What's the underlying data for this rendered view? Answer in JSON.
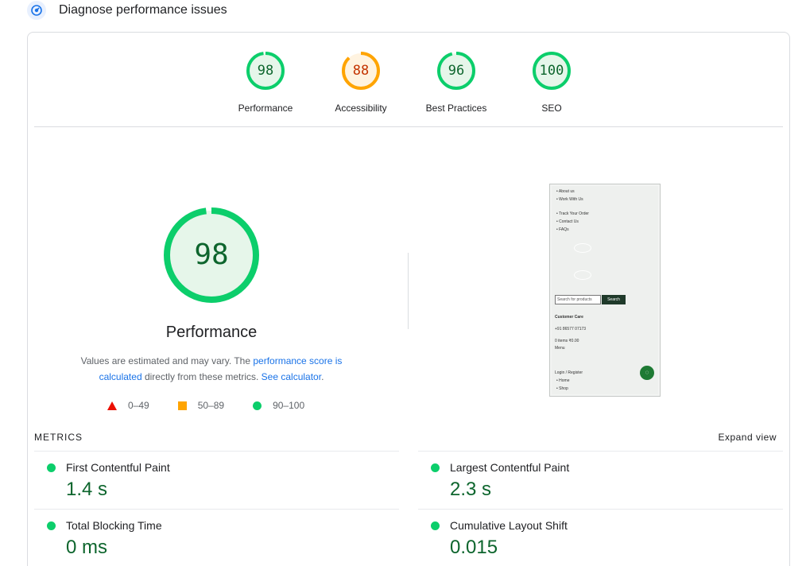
{
  "header": {
    "title": "Diagnose performance issues",
    "icon": "speed-icon"
  },
  "categories": [
    {
      "score": "98",
      "label": "Performance",
      "value": 98,
      "color": "#0cce6b",
      "fill": "#e6f6ea",
      "text": "#0d652d"
    },
    {
      "score": "88",
      "label": "Accessibility",
      "value": 88,
      "color": "#ffa400",
      "fill": "#fff3e0",
      "text": "#c33300"
    },
    {
      "score": "96",
      "label": "Best Practices",
      "value": 96,
      "color": "#0cce6b",
      "fill": "#e6f6ea",
      "text": "#0d652d"
    },
    {
      "score": "100",
      "label": "SEO",
      "value": 100,
      "color": "#0cce6b",
      "fill": "#e6f6ea",
      "text": "#0d652d"
    }
  ],
  "performance": {
    "score": "98",
    "value": 98,
    "title": "Performance",
    "desc_prefix": "Values are estimated and may vary. The ",
    "desc_link": "performance score is calculated",
    "desc_middle": " directly from these metrics. ",
    "desc_calc": "See calculator",
    "desc_suffix": "."
  },
  "legend": {
    "poor": "0–49",
    "average": "50–89",
    "good": "90–100"
  },
  "screenshot": {
    "items": [
      "About us",
      "Work With Us",
      "Track Your Order",
      "Contact Us",
      "FAQs"
    ],
    "search_placeholder": "Search for products",
    "search_button": "Search",
    "customer_care": "Customer Care",
    "phone": "+91 86577 07173",
    "cart": "0 items ₹0.00",
    "menu": "Menu",
    "login": "Login / Register",
    "nav": [
      "Home",
      "Shop"
    ]
  },
  "metrics": {
    "title": "METRICS",
    "expand": "Expand view",
    "items": [
      {
        "label": "First Contentful Paint",
        "value": "1.4 s"
      },
      {
        "label": "Largest Contentful Paint",
        "value": "2.3 s"
      },
      {
        "label": "Total Blocking Time",
        "value": "0 ms"
      },
      {
        "label": "Cumulative Layout Shift",
        "value": "0.015"
      }
    ]
  },
  "colors": {
    "good": "#0cce6b",
    "average": "#ffa400",
    "poor": "#eb0f00",
    "link": "#1a73e8"
  }
}
